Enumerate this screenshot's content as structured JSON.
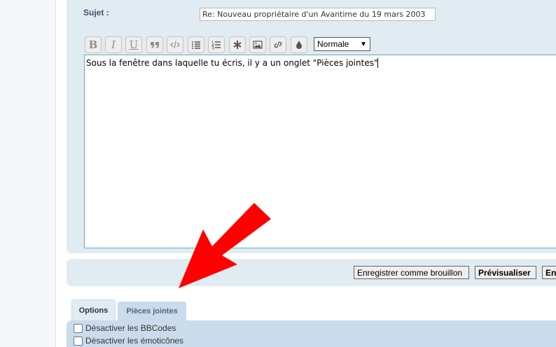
{
  "form": {
    "subject_label": "Sujet :",
    "subject_value": "Re: Nouveau propriétaire d'un Avantime du 19 mars 2003",
    "message_text": "Sous la fenêtre dans laquelle tu écris, il y a un onglet \"Pièces jointes\""
  },
  "toolbar": {
    "buttons": [
      "bold",
      "italic",
      "underline",
      "quote",
      "code",
      "list",
      "list-numbered",
      "list-item",
      "image",
      "link",
      "color"
    ],
    "bold_label": "B",
    "italic_label": "I",
    "underline_label": "U",
    "font_size_selected": "Normale"
  },
  "actions": {
    "draft_label": "Enregistrer comme brouillon",
    "preview_label": "Prévisualiser",
    "submit_label": "En"
  },
  "tabs": [
    {
      "label": "Options",
      "active": true
    },
    {
      "label": "Pièces jointes",
      "active": false
    }
  ],
  "options": [
    {
      "label": "Désactiver les BBCodes",
      "checked": false
    },
    {
      "label": "Désactiver les émoticônes",
      "checked": false
    }
  ],
  "colors": {
    "panel": "#e1ebf2",
    "tab_panel": "#cadceb",
    "textarea_border": "#69acb9",
    "annotation_arrow": "#ff0000"
  }
}
